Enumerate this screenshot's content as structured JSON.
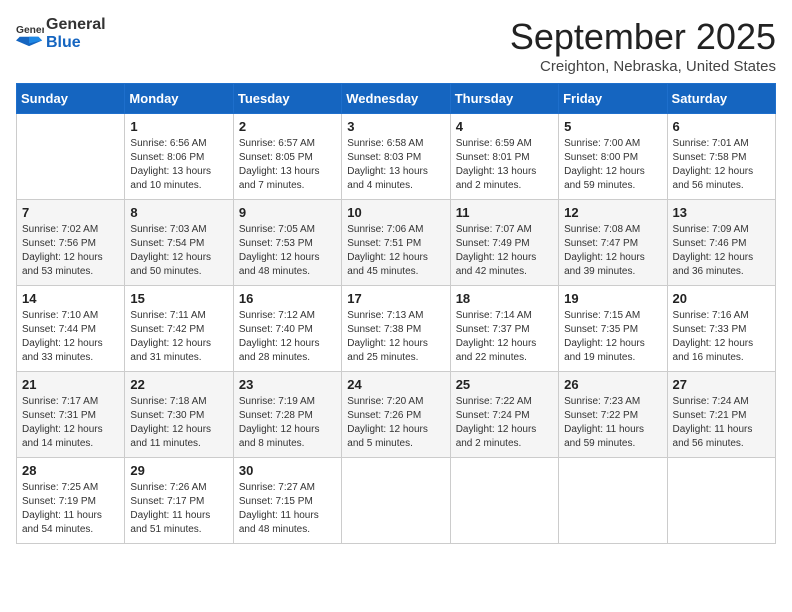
{
  "header": {
    "logo_general": "General",
    "logo_blue": "Blue",
    "month_title": "September 2025",
    "location": "Creighton, Nebraska, United States"
  },
  "weekdays": [
    "Sunday",
    "Monday",
    "Tuesday",
    "Wednesday",
    "Thursday",
    "Friday",
    "Saturday"
  ],
  "weeks": [
    [
      {
        "day": "",
        "sunrise": "",
        "sunset": "",
        "daylight": ""
      },
      {
        "day": "1",
        "sunrise": "Sunrise: 6:56 AM",
        "sunset": "Sunset: 8:06 PM",
        "daylight": "Daylight: 13 hours and 10 minutes."
      },
      {
        "day": "2",
        "sunrise": "Sunrise: 6:57 AM",
        "sunset": "Sunset: 8:05 PM",
        "daylight": "Daylight: 13 hours and 7 minutes."
      },
      {
        "day": "3",
        "sunrise": "Sunrise: 6:58 AM",
        "sunset": "Sunset: 8:03 PM",
        "daylight": "Daylight: 13 hours and 4 minutes."
      },
      {
        "day": "4",
        "sunrise": "Sunrise: 6:59 AM",
        "sunset": "Sunset: 8:01 PM",
        "daylight": "Daylight: 13 hours and 2 minutes."
      },
      {
        "day": "5",
        "sunrise": "Sunrise: 7:00 AM",
        "sunset": "Sunset: 8:00 PM",
        "daylight": "Daylight: 12 hours and 59 minutes."
      },
      {
        "day": "6",
        "sunrise": "Sunrise: 7:01 AM",
        "sunset": "Sunset: 7:58 PM",
        "daylight": "Daylight: 12 hours and 56 minutes."
      }
    ],
    [
      {
        "day": "7",
        "sunrise": "Sunrise: 7:02 AM",
        "sunset": "Sunset: 7:56 PM",
        "daylight": "Daylight: 12 hours and 53 minutes."
      },
      {
        "day": "8",
        "sunrise": "Sunrise: 7:03 AM",
        "sunset": "Sunset: 7:54 PM",
        "daylight": "Daylight: 12 hours and 50 minutes."
      },
      {
        "day": "9",
        "sunrise": "Sunrise: 7:05 AM",
        "sunset": "Sunset: 7:53 PM",
        "daylight": "Daylight: 12 hours and 48 minutes."
      },
      {
        "day": "10",
        "sunrise": "Sunrise: 7:06 AM",
        "sunset": "Sunset: 7:51 PM",
        "daylight": "Daylight: 12 hours and 45 minutes."
      },
      {
        "day": "11",
        "sunrise": "Sunrise: 7:07 AM",
        "sunset": "Sunset: 7:49 PM",
        "daylight": "Daylight: 12 hours and 42 minutes."
      },
      {
        "day": "12",
        "sunrise": "Sunrise: 7:08 AM",
        "sunset": "Sunset: 7:47 PM",
        "daylight": "Daylight: 12 hours and 39 minutes."
      },
      {
        "day": "13",
        "sunrise": "Sunrise: 7:09 AM",
        "sunset": "Sunset: 7:46 PM",
        "daylight": "Daylight: 12 hours and 36 minutes."
      }
    ],
    [
      {
        "day": "14",
        "sunrise": "Sunrise: 7:10 AM",
        "sunset": "Sunset: 7:44 PM",
        "daylight": "Daylight: 12 hours and 33 minutes."
      },
      {
        "day": "15",
        "sunrise": "Sunrise: 7:11 AM",
        "sunset": "Sunset: 7:42 PM",
        "daylight": "Daylight: 12 hours and 31 minutes."
      },
      {
        "day": "16",
        "sunrise": "Sunrise: 7:12 AM",
        "sunset": "Sunset: 7:40 PM",
        "daylight": "Daylight: 12 hours and 28 minutes."
      },
      {
        "day": "17",
        "sunrise": "Sunrise: 7:13 AM",
        "sunset": "Sunset: 7:38 PM",
        "daylight": "Daylight: 12 hours and 25 minutes."
      },
      {
        "day": "18",
        "sunrise": "Sunrise: 7:14 AM",
        "sunset": "Sunset: 7:37 PM",
        "daylight": "Daylight: 12 hours and 22 minutes."
      },
      {
        "day": "19",
        "sunrise": "Sunrise: 7:15 AM",
        "sunset": "Sunset: 7:35 PM",
        "daylight": "Daylight: 12 hours and 19 minutes."
      },
      {
        "day": "20",
        "sunrise": "Sunrise: 7:16 AM",
        "sunset": "Sunset: 7:33 PM",
        "daylight": "Daylight: 12 hours and 16 minutes."
      }
    ],
    [
      {
        "day": "21",
        "sunrise": "Sunrise: 7:17 AM",
        "sunset": "Sunset: 7:31 PM",
        "daylight": "Daylight: 12 hours and 14 minutes."
      },
      {
        "day": "22",
        "sunrise": "Sunrise: 7:18 AM",
        "sunset": "Sunset: 7:30 PM",
        "daylight": "Daylight: 12 hours and 11 minutes."
      },
      {
        "day": "23",
        "sunrise": "Sunrise: 7:19 AM",
        "sunset": "Sunset: 7:28 PM",
        "daylight": "Daylight: 12 hours and 8 minutes."
      },
      {
        "day": "24",
        "sunrise": "Sunrise: 7:20 AM",
        "sunset": "Sunset: 7:26 PM",
        "daylight": "Daylight: 12 hours and 5 minutes."
      },
      {
        "day": "25",
        "sunrise": "Sunrise: 7:22 AM",
        "sunset": "Sunset: 7:24 PM",
        "daylight": "Daylight: 12 hours and 2 minutes."
      },
      {
        "day": "26",
        "sunrise": "Sunrise: 7:23 AM",
        "sunset": "Sunset: 7:22 PM",
        "daylight": "Daylight: 11 hours and 59 minutes."
      },
      {
        "day": "27",
        "sunrise": "Sunrise: 7:24 AM",
        "sunset": "Sunset: 7:21 PM",
        "daylight": "Daylight: 11 hours and 56 minutes."
      }
    ],
    [
      {
        "day": "28",
        "sunrise": "Sunrise: 7:25 AM",
        "sunset": "Sunset: 7:19 PM",
        "daylight": "Daylight: 11 hours and 54 minutes."
      },
      {
        "day": "29",
        "sunrise": "Sunrise: 7:26 AM",
        "sunset": "Sunset: 7:17 PM",
        "daylight": "Daylight: 11 hours and 51 minutes."
      },
      {
        "day": "30",
        "sunrise": "Sunrise: 7:27 AM",
        "sunset": "Sunset: 7:15 PM",
        "daylight": "Daylight: 11 hours and 48 minutes."
      },
      {
        "day": "",
        "sunrise": "",
        "sunset": "",
        "daylight": ""
      },
      {
        "day": "",
        "sunrise": "",
        "sunset": "",
        "daylight": ""
      },
      {
        "day": "",
        "sunrise": "",
        "sunset": "",
        "daylight": ""
      },
      {
        "day": "",
        "sunrise": "",
        "sunset": "",
        "daylight": ""
      }
    ]
  ]
}
